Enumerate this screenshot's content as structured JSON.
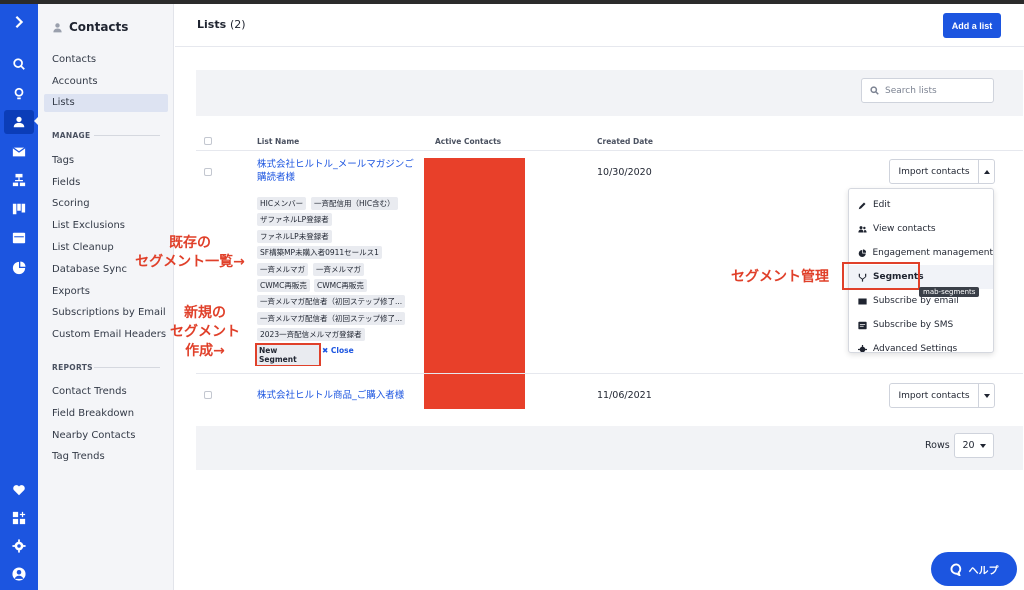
{
  "sidebar": {
    "header": "Contacts",
    "items": [
      "Contacts",
      "Accounts",
      "Lists"
    ],
    "manage_label": "MANAGE",
    "manage_items": [
      "Tags",
      "Fields",
      "Scoring",
      "List Exclusions",
      "List Cleanup",
      "Database Sync",
      "Exports",
      "Subscriptions by Email",
      "Custom Email Headers"
    ],
    "reports_label": "REPORTS",
    "reports_items": [
      "Contact Trends",
      "Field Breakdown",
      "Nearby Contacts",
      "Tag Trends"
    ]
  },
  "page": {
    "title": "Lists",
    "count": "(2)",
    "add_button": "Add a list",
    "search_placeholder": "Search lists"
  },
  "table": {
    "headers": [
      "List Name",
      "Active Contacts",
      "Created Date"
    ],
    "rows": [
      {
        "name": "株式会社ヒルトル_メールマガジンご購読者様",
        "date": "10/30/2020",
        "import_label": "Import contacts",
        "segments": [
          "HICメンバー",
          "一斉配信用（HIC含む）",
          "ザファネルLP登録者",
          "ファネルLP未登録者",
          "SF構築MP未購入者0911セールス1",
          "一斉メルマガ",
          "一斉メルマガ",
          "CWMC再販売",
          "CWMC再販売",
          "一斉メルマガ配信者（初回ステップ修了...",
          "一斉メルマガ配信者（初回ステップ修了...",
          "2023一斉配信メルマガ登録者"
        ],
        "new_segment": "New Segment",
        "close": "Close"
      },
      {
        "name": "株式会社ヒルトル商品_ご購入者様",
        "date": "11/06/2021",
        "import_label": "Import contacts"
      }
    ]
  },
  "dropdown": {
    "items": [
      "Edit",
      "View contacts",
      "Engagement management",
      "Segments",
      "Subscribe by email",
      "Subscribe by SMS",
      "Advanced Settings"
    ],
    "tooltip": "mab-segments"
  },
  "pagination": {
    "rows_label": "Rows",
    "rows_value": "20"
  },
  "help": {
    "label": "ヘルプ"
  },
  "annotations": {
    "existing_line1": "既存の",
    "existing_line2": "セグメント一覧→",
    "new_line1": "新規の",
    "new_line2": "セグメント",
    "new_line3": "作成→",
    "segment_mgmt": "セグメント管理"
  },
  "colors": {
    "brand": "#1c55e0",
    "annotation": "#e0402a",
    "redaction": "#e8402a"
  },
  "icons": {
    "rail": [
      "logo-icon",
      "search-icon",
      "lightbulb-icon",
      "contacts-icon",
      "email-icon",
      "automation-icon",
      "pipeline-icon",
      "site-icon",
      "reports-icon",
      "heart-icon",
      "apps-icon",
      "settings-icon",
      "avatar-icon"
    ]
  }
}
